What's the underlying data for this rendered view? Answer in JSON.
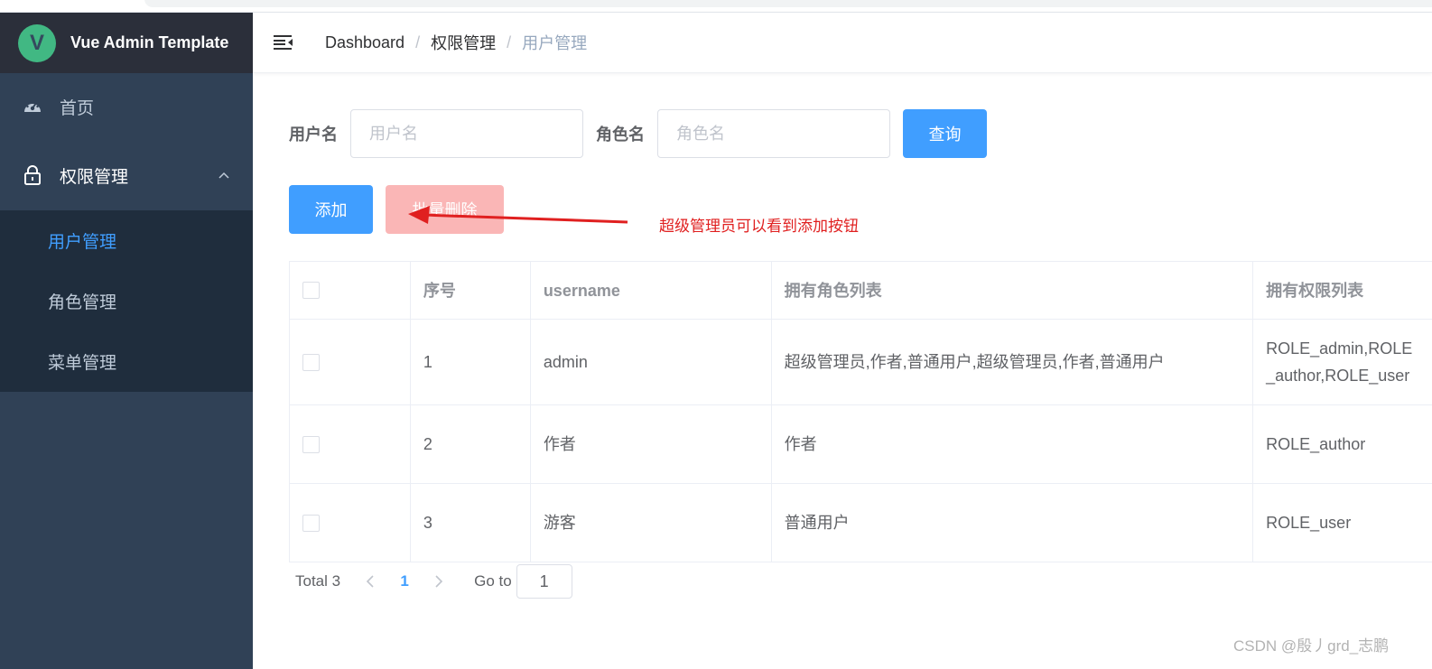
{
  "app": {
    "title": "Vue Admin Template",
    "logo_letter": "V"
  },
  "sidebar": {
    "items": [
      {
        "label": "首页",
        "icon": "dashboard-icon"
      },
      {
        "label": "权限管理",
        "icon": "lock-icon",
        "expanded": true,
        "children": [
          {
            "label": "用户管理",
            "active": true
          },
          {
            "label": "角色管理"
          },
          {
            "label": "菜单管理"
          }
        ]
      }
    ]
  },
  "breadcrumb": [
    "Dashboard",
    "权限管理",
    "用户管理"
  ],
  "breadcrumb_separator": "/",
  "search": {
    "username_label": "用户名",
    "username_placeholder": "用户名",
    "role_label": "角色名",
    "role_placeholder": "角色名",
    "query_button": "查询"
  },
  "actions": {
    "add_button": "添加",
    "batch_delete_button": "批量删除"
  },
  "annotation": "超级管理员可以看到添加按钮",
  "table": {
    "columns": [
      "序号",
      "username",
      "拥有角色列表",
      "拥有权限列表"
    ],
    "rows": [
      {
        "index": "1",
        "username": "admin",
        "roles": "超级管理员,作者,普通用户,超级管理员,作者,普通用户",
        "perms_line1": "ROLE_admin,ROLE",
        "perms_line2": "_author,ROLE_user"
      },
      {
        "index": "2",
        "username": "作者",
        "roles": "作者",
        "perms_line1": "ROLE_author"
      },
      {
        "index": "3",
        "username": "游客",
        "roles": "普通用户",
        "perms_line1": "ROLE_user"
      }
    ]
  },
  "pagination": {
    "total_text": "Total 3",
    "current_page": "1",
    "goto_label": "Go to",
    "goto_value": "1"
  },
  "watermark": "CSDN @殷丿grd_志鹏",
  "colors": {
    "primary": "#409eff",
    "sidebar_bg": "#304156",
    "submenu_bg": "#1f2d3d",
    "logo_bg": "#2b2f3a",
    "annotation": "#e02020",
    "danger_disabled": "#fab6b6"
  }
}
